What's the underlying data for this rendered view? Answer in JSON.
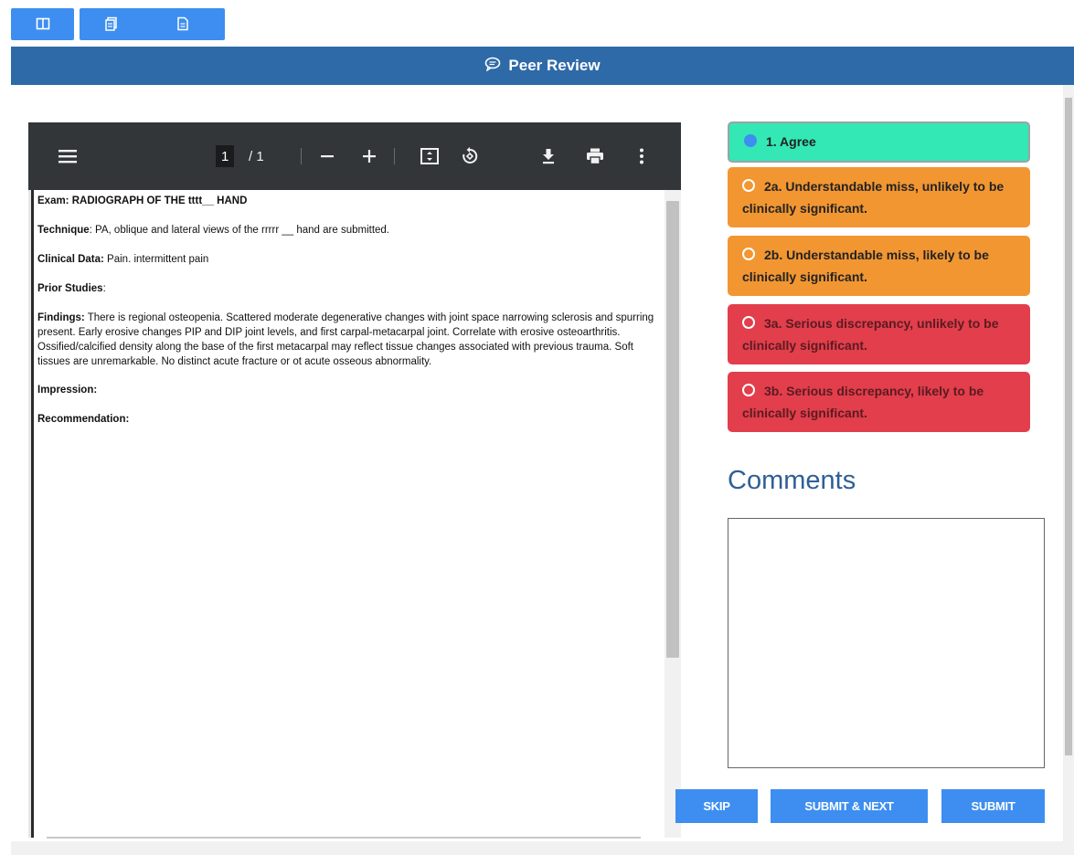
{
  "header": {
    "title": "Peer Review"
  },
  "pdf_viewer": {
    "current_page": "1",
    "page_total": "/ 1",
    "report": [
      {
        "label": "Exam: RADIOGRAPH OF THE tttt__ HAND",
        "body": ""
      },
      {
        "label": "Technique",
        "body": ": PA, oblique and lateral views of the   rrrrr __  hand are submitted."
      },
      {
        "label": "Clinical Data:",
        "body": " Pain. intermittent pain"
      },
      {
        "label": "Prior Studies",
        "body": ":"
      },
      {
        "label": "Findings:",
        "body": " There is regional osteopenia.  Scattered moderate degenerative changes with joint space narrowing sclerosis and spurring present.  Early erosive changes PIP and DIP joint levels, and first carpal-metacarpal joint.  Correlate with erosive osteoarthritis.  Ossified/calcified density along the base of the first metacarpal may reflect tissue changes associated with previous trauma.  Soft tissues are unremarkable.  No distinct acute fracture or ot acute osseous abnormality."
      },
      {
        "label": "Impression:",
        "body": ""
      },
      {
        "label": "Recommendation:",
        "body": ""
      }
    ]
  },
  "review_options": [
    {
      "label": "1. Agree",
      "selected": true,
      "color": "#33e8b5"
    },
    {
      "label": "2a. Understandable miss, unlikely to be clinically significant.",
      "selected": false,
      "color": "#f29632"
    },
    {
      "label": "2b. Understandable miss, likely to be clinically significant.",
      "selected": false,
      "color": "#f29632"
    },
    {
      "label": "3a. Serious discrepancy, unlikely to be clinically significant.",
      "selected": false,
      "color": "#e23e4c"
    },
    {
      "label": "3b. Serious discrepancy, likely to be clinically significant.",
      "selected": false,
      "color": "#e23e4c"
    }
  ],
  "comments": {
    "label": "Comments",
    "value": ""
  },
  "actions": {
    "skip": "SKIP",
    "submit_next": "SUBMIT & NEXT",
    "submit": "SUBMIT"
  },
  "icons": {
    "layout": "layout-columns-icon",
    "copy": "document-copy-icon",
    "document": "document-icon",
    "comment": "comment-bubble-icon",
    "menu": "menu-icon",
    "zoom_out": "minus-icon",
    "zoom_in": "plus-icon",
    "fit": "fit-page-icon",
    "rotate": "rotate-icon",
    "download": "download-icon",
    "print": "print-icon",
    "more": "more-vertical-icon"
  }
}
